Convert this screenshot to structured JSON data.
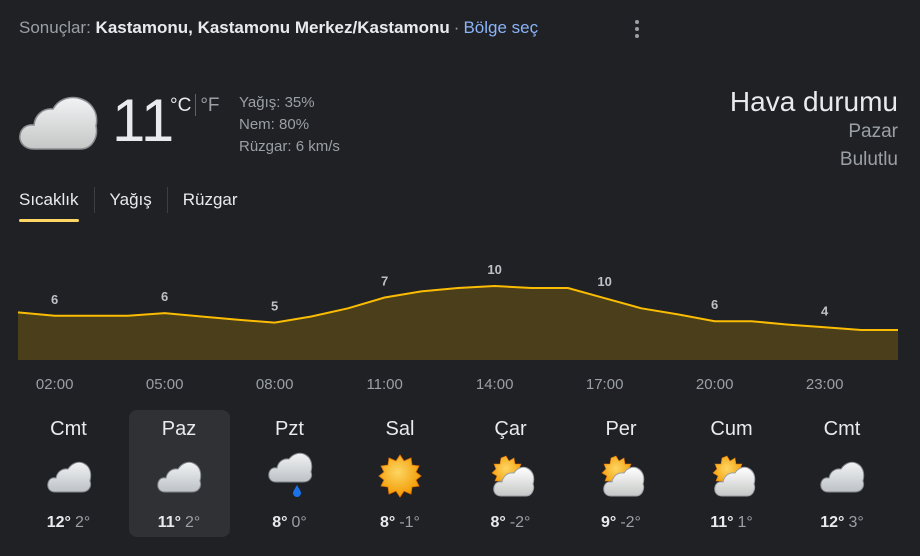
{
  "header": {
    "prefix": "Sonuçlar: ",
    "location": "Kastamonu, Kastamonu Merkez/Kastamonu",
    "separator": "·",
    "region_link": "Bölge seç",
    "more_icon": "more-vert-icon"
  },
  "current": {
    "icon": "cloud-icon",
    "temp": "11",
    "unit_c": "°C",
    "unit_f": "°F",
    "precip": "Yağış: 35%",
    "humidity": "Nem: 80%",
    "wind": "Rüzgar: 6 km/s"
  },
  "summary": {
    "title": "Hava durumu",
    "day": "Pazar",
    "condition": "Bulutlu"
  },
  "tabs": [
    "Sıcaklık",
    "Yağış",
    "Rüzgar"
  ],
  "chart_data": {
    "type": "area",
    "labels": [
      "6",
      "6",
      "5",
      "7",
      "10",
      "10",
      "6",
      "4"
    ],
    "times": [
      "02:00",
      "05:00",
      "08:00",
      "11:00",
      "14:00",
      "17:00",
      "20:00",
      "23:00"
    ],
    "values": [
      6.6,
      6.1,
      6.1,
      6.1,
      6.5,
      6.0,
      5.5,
      5.1,
      6.0,
      7.2,
      8.8,
      9.7,
      10.2,
      10.5,
      10.2,
      10.2,
      8.7,
      7.2,
      6.3,
      5.3,
      5.3,
      4.8,
      4.4,
      4.0,
      4.0
    ],
    "line_color": "#fbbc04",
    "fill_color": "#4a3f1a"
  },
  "days": [
    {
      "name": "Cmt",
      "icon": "cloud-icon",
      "hi": "12°",
      "lo": "2°",
      "active": false
    },
    {
      "name": "Paz",
      "icon": "cloud-icon",
      "hi": "11°",
      "lo": "2°",
      "active": true
    },
    {
      "name": "Pzt",
      "icon": "rain-cloud-icon",
      "hi": "8°",
      "lo": "0°",
      "active": false
    },
    {
      "name": "Sal",
      "icon": "sun-icon",
      "hi": "8°",
      "lo": "-1°",
      "active": false
    },
    {
      "name": "Çar",
      "icon": "partly-cloudy-icon",
      "hi": "8°",
      "lo": "-2°",
      "active": false
    },
    {
      "name": "Per",
      "icon": "partly-cloudy-icon",
      "hi": "9°",
      "lo": "-2°",
      "active": false
    },
    {
      "name": "Cum",
      "icon": "partly-cloudy-icon",
      "hi": "11°",
      "lo": "1°",
      "active": false
    },
    {
      "name": "Cmt",
      "icon": "cloud-icon",
      "hi": "12°",
      "lo": "3°",
      "active": false
    }
  ]
}
